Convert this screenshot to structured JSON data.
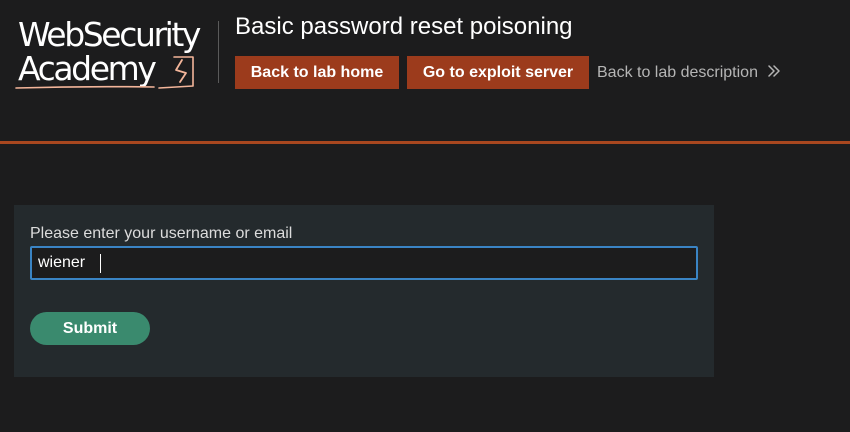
{
  "logo": {
    "line1": "WebSecurity",
    "line2": "Academy"
  },
  "header": {
    "title": "Basic password reset poisoning",
    "back_to_lab_home": "Back to lab home",
    "go_to_exploit_server": "Go to exploit server",
    "back_to_lab_description": "Back to lab description"
  },
  "form": {
    "label": "Please enter your username or email",
    "username_value": "wiener",
    "submit_label": "Submit"
  },
  "colors": {
    "background": "#1c1c1d",
    "accent_orange": "#9c3b1c",
    "divider_orange": "#a8471f",
    "panel": "#242a2d",
    "submit_green": "#3a8a6e",
    "input_focus_border": "#3a84c4"
  },
  "icons": {
    "logo_mark": "lightning-bolt-icon",
    "back_chevron": "double-chevron-right-icon"
  }
}
